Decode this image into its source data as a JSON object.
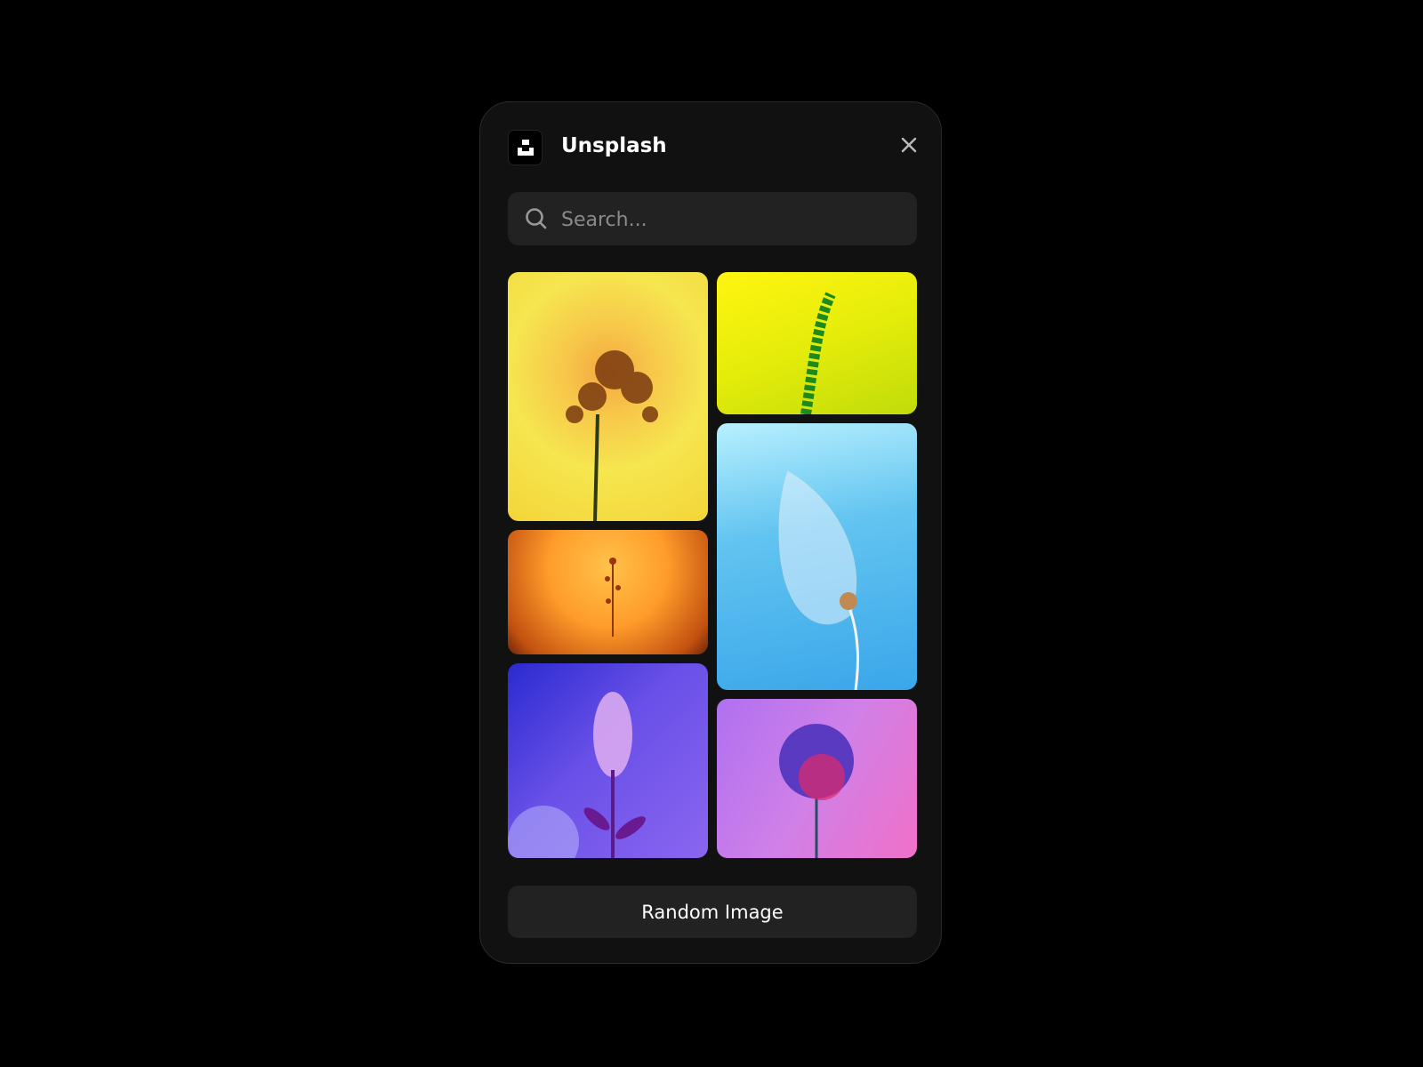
{
  "header": {
    "title": "Unsplash",
    "logo_icon": "unsplash-logo",
    "close_icon": "close-icon"
  },
  "search": {
    "placeholder": "Search...",
    "value": "",
    "icon": "search-icon"
  },
  "images": [
    {
      "id": "yellow-flower"
    },
    {
      "id": "green-fern"
    },
    {
      "id": "orange-sprig"
    },
    {
      "id": "blue-physalis-leaf"
    },
    {
      "id": "purple-flower-spike"
    },
    {
      "id": "pink-allium"
    }
  ],
  "actions": {
    "random_label": "Random Image"
  },
  "colors": {
    "panel": "#111111",
    "field": "#222222",
    "text": "#ffffff",
    "placeholder": "#8a8a8a"
  }
}
